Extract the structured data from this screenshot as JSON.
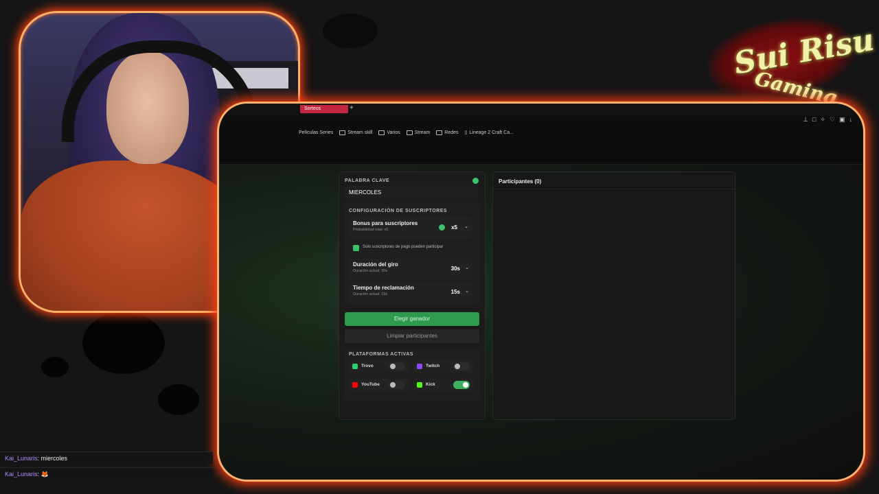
{
  "colors": {
    "accent_green": "#3cc26a",
    "frame_glow": "#ff4010",
    "tab_red": "#c2253f",
    "chat_user": "#b08dff"
  },
  "logo": {
    "main": "Sui Risu",
    "sub": "Gaming"
  },
  "browser": {
    "tab_label": "Sorteos",
    "new_tab": "+",
    "controls_icons": [
      "pin-icon",
      "square-icon",
      "puzzle-icon",
      "heart-icon",
      "window-icon",
      "download-icon",
      "menu-icon"
    ],
    "bookmarks": [
      {
        "label": "Películas Series",
        "icon": "folder-icon"
      },
      {
        "label": "Stream skill",
        "icon": "folder-icon"
      },
      {
        "label": "Varios",
        "icon": "folder-icon"
      },
      {
        "label": "Stream",
        "icon": "folder-icon"
      },
      {
        "label": "Redes",
        "icon": "folder-icon"
      },
      {
        "label": "Lineage 2 Craft Ca...",
        "icon": "page-icon"
      }
    ]
  },
  "app": {
    "keyword": {
      "label": "PALABRA CLAVE",
      "value": "MIERCOLES"
    },
    "subs_config": {
      "title": "CONFIGURACIÓN DE SUSCRIPTORES",
      "bonus": {
        "title": "Bonus para suscriptores",
        "sub": "Probabilidad total: x5",
        "value": "x5"
      },
      "paid_only": {
        "label": "Solo suscriptores de pago pueden participar",
        "checked": true
      },
      "spin": {
        "title": "Duración del giro",
        "sub": "Duración actual: 30s",
        "value": "30s"
      },
      "claim": {
        "title": "Tiempo de reclamación",
        "sub": "Duración actual: 15s",
        "value": "15s"
      }
    },
    "pick_winner": "Elegir ganador",
    "clear_participants": "Limpiar participantes",
    "platforms": {
      "title": "PLATAFORMAS ACTIVAS",
      "items": [
        {
          "name": "Trovo",
          "enabled": false,
          "color": "#2ed06e"
        },
        {
          "name": "Twitch",
          "enabled": false,
          "color": "#9146ff"
        },
        {
          "name": "YouTube",
          "enabled": false,
          "color": "#ff0000"
        },
        {
          "name": "Kick",
          "enabled": true,
          "color": "#53fc18"
        }
      ]
    },
    "participants": {
      "title": "Participantes (0)"
    }
  },
  "chat": [
    {
      "user": "Kai_Lunaris",
      "message": "miercoles"
    },
    {
      "user": "Kai_Lunaris",
      "message": ""
    }
  ]
}
